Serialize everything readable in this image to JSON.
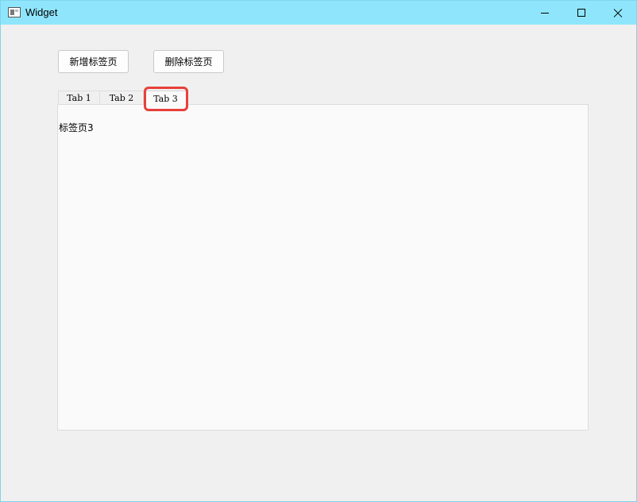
{
  "window": {
    "title": "Widget",
    "icon": "window-app-icon",
    "controls": {
      "minimize": "minimize-icon",
      "maximize": "maximize-icon",
      "close": "close-icon"
    }
  },
  "toolbar": {
    "add_label": "新增标签页",
    "delete_label": "删除标签页"
  },
  "tabs": [
    {
      "label": "Tab 1",
      "selected": false
    },
    {
      "label": "Tab 2",
      "selected": false
    },
    {
      "label": "Tab 3",
      "selected": true
    }
  ],
  "pane": {
    "content": "标签页3"
  },
  "colors": {
    "titlebar": "#8fe6fc",
    "window_bg": "#f0f0f0",
    "pane_bg": "#fafafa",
    "highlight": "#e8403a"
  }
}
